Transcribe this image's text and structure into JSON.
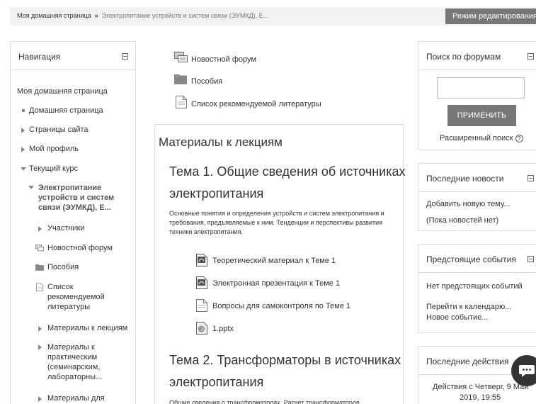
{
  "breadcrumb": {
    "home": "Моя домашняя страница",
    "separator": "»",
    "course": "Электропитание устройств и систем связи (ЭУМКД), Е..."
  },
  "edit_button": "Режим редактирования",
  "nav": {
    "title": "Навигация",
    "my_home": "Моя домашняя страница",
    "home_page": "Домашняя страница",
    "site_pages": "Страницы сайта",
    "my_profile": "Мой профиль",
    "current_course": "Текущий курс",
    "course_name": "Электропитание устройств и систем связи (ЭУМКД), Е...",
    "participants": "Участники",
    "news_forum": "Новостной форум",
    "manuals": "Пособия",
    "reading_list": "Список рекомендуемой литературы",
    "lecture_materials": "Материалы к лекциям",
    "practical_materials": "Материалы к практическим (семинарским, лабораторны...",
    "materials_for": "Материалы для"
  },
  "main": {
    "top_links": [
      "Новостной форум",
      "Пособия",
      "Список рекомендуемой литературы"
    ],
    "section_title": "Материалы к лекциям",
    "topic1": {
      "title_line1": "Тема 1. Общие сведения об источниках",
      "title_line2": "электропитания",
      "description": "Основные понятия и определения устройств и систем электропитания и требования, предъявляемые к ним. Тенденции и перспективы развития техники электропитания.",
      "resources": [
        "Теоретический материал к Теме 1",
        "Электронная презентация к Теме 1",
        "Вопросы для самоконтроля по Теме 1",
        "1.pptx"
      ]
    },
    "topic2": {
      "title_line1": "Тема 2. Трансформаторы в источниках",
      "title_line2": "электропитания",
      "description": "Общие сведения о трансформаторах. Расчет трансформаторов"
    }
  },
  "forum_search": {
    "title": "Поиск по форумам",
    "input_value": "",
    "apply": "ПРИМЕНИТЬ",
    "advanced": "Расширенный поиск"
  },
  "latest_news": {
    "title": "Последние новости",
    "add_topic": "Добавить новую тему...",
    "empty": "(Пока новостей нет)"
  },
  "upcoming_events": {
    "title": "Предстоящие события",
    "none": "Нет предстоящих событий",
    "go_calendar": "Перейти к календарю...",
    "new_event": "Новое событие..."
  },
  "recent_activity": {
    "title": "Последние действия",
    "since_line1": "Действия с Четверг, 9 Май",
    "since_line2": "2019, 19:55"
  },
  "icons": [
    "collapse-icon",
    "forum-icon",
    "folder-icon",
    "page-icon",
    "pdf-icon",
    "pptx-icon",
    "help-icon",
    "chat-icon"
  ]
}
